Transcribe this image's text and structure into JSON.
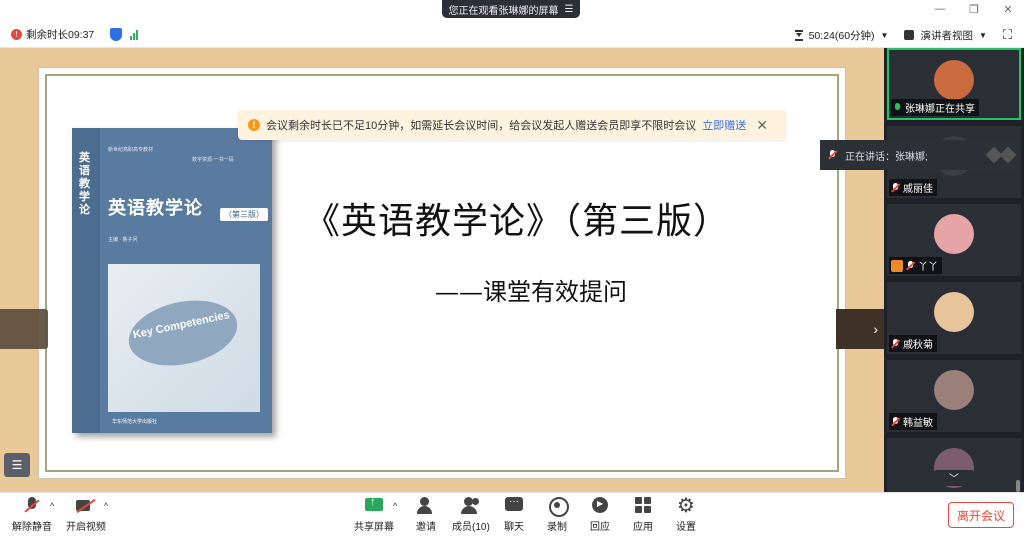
{
  "window": {
    "share_indicator": "您正在观看张琳娜的屏幕",
    "menu_icon": "hamburger-icon"
  },
  "status": {
    "remaining_time": "剩余时长09:37",
    "duration": "50:24(60分钟)",
    "view_mode": "演讲者视图"
  },
  "notice": {
    "text": "会议剩余时长已不足10分钟，如需延长会议时间，给会议发起人赠送会员即享不限时会议",
    "link": "立即赠送",
    "close": "✕"
  },
  "slide": {
    "title": "《英语教学论》（第三版）",
    "subtitle": "——课堂有效提问",
    "book": {
      "spine": "英语教学论",
      "title": "英语教学论",
      "edition": "（第三版）",
      "tag1": "新世纪高职高专教材",
      "tag2": "数字资源·一书一码",
      "editor": "主编 · 鲁子问",
      "bubble": "Key Competencies",
      "publisher": "华东师范大学出版社"
    }
  },
  "speaking": {
    "label": "正在讲话：张琳娜;"
  },
  "participants": [
    {
      "name": "张琳娜正在共享",
      "avatar_color": "#c96a3f",
      "mic": "on"
    },
    {
      "name": "戚丽佳",
      "avatar_color": "#3a3f46",
      "mic": "off"
    },
    {
      "name": "丫丫",
      "avatar_color": "#e6a4a8",
      "mic": "off",
      "host": true
    },
    {
      "name": "戚秋菊",
      "avatar_color": "#e8c49a",
      "mic": "off"
    },
    {
      "name": "韩益敏",
      "avatar_color": "#9a7f7a",
      "mic": "off"
    },
    {
      "name": "",
      "avatar_color": "#7c5c6e",
      "mic": "off"
    }
  ],
  "toolbar": {
    "unmute": "解除静音",
    "start_video": "开启视频",
    "share_screen": "共享屏幕",
    "invite": "邀请",
    "members": "成员(10)",
    "chat": "聊天",
    "record": "录制",
    "replay": "回应",
    "apps": "应用",
    "settings": "设置",
    "leave": "离开会议"
  },
  "colors": {
    "accent_green": "#27c268",
    "danger": "#e64a3b",
    "link": "#2f6fe4",
    "stage_bg": "#e9c99a",
    "panel_bg": "#1e2127"
  }
}
